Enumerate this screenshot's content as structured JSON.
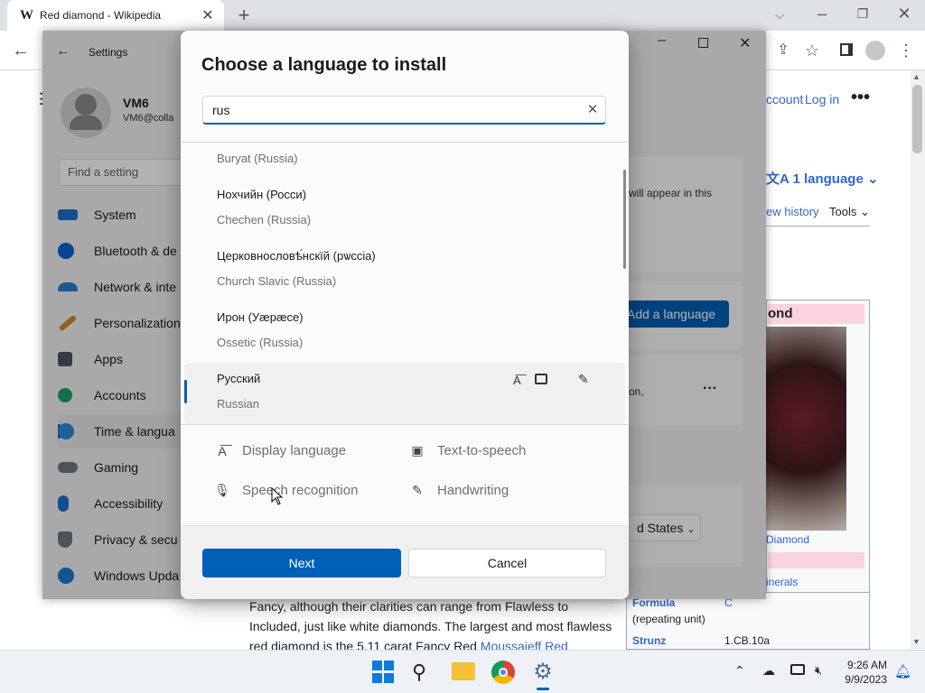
{
  "browser": {
    "tab_title": "Red diamond - Wikipedia",
    "tab_icon": "W",
    "new_tab": "+",
    "tab_close": "✕"
  },
  "wiki": {
    "account": "ccount",
    "login": "Log in",
    "language_btn": "1 language",
    "view_history": "ew history",
    "tools": "Tools",
    "infobox_title": "ond",
    "infobox_caption": "Diamond",
    "minerals": "inerals",
    "formula_label": "Formula",
    "formula_value": "C",
    "formula_sub": "(repeating unit)",
    "strunz_label": "Strunz",
    "strunz_value": "1.CB.10a",
    "paragraph_l1": "Fancy, although their clarities can range from Flawless to",
    "paragraph_l2": "Included, just like white diamonds. The largest and most flawless",
    "paragraph_l3_a": "red diamond is the 5.11 carat Fancy Red ",
    "paragraph_l3_link": "Moussaieff Red"
  },
  "settings": {
    "title": "Settings",
    "user_name": "VM6",
    "user_email": "VM6@colla",
    "find_placeholder": "Find a setting",
    "nav": [
      "System",
      "Bluetooth & de",
      "Network & inte",
      "Personalization",
      "Apps",
      "Accounts",
      "Time & langua",
      "Gaming",
      "Accessibility",
      "Privacy & secu",
      "Windows Upda"
    ],
    "content_text": "will appear in this",
    "add_language": "Add a language",
    "region_value": "d States",
    "content_text2": "on,"
  },
  "dialog": {
    "title": "Choose a language to install",
    "search_value": "rus",
    "items": [
      {
        "native": "",
        "english": "Buryat (Russia)"
      },
      {
        "native": "Нохчийн (Росси)",
        "english": "Chechen (Russia)"
      },
      {
        "native": "Церковнословѣ́нскїй (рѡссіа)",
        "english": "Church Slavic (Russia)"
      },
      {
        "native": "Ирон (Уæрæсе)",
        "english": "Ossetic (Russia)"
      },
      {
        "native": "Русский",
        "english": "Russian"
      }
    ],
    "features": {
      "display": "Display language",
      "tts": "Text-to-speech",
      "speech": "Speech recognition",
      "handwriting": "Handwriting"
    },
    "next": "Next",
    "cancel": "Cancel"
  },
  "taskbar": {
    "time": "9:26 AM",
    "date": "9/9/2023"
  }
}
